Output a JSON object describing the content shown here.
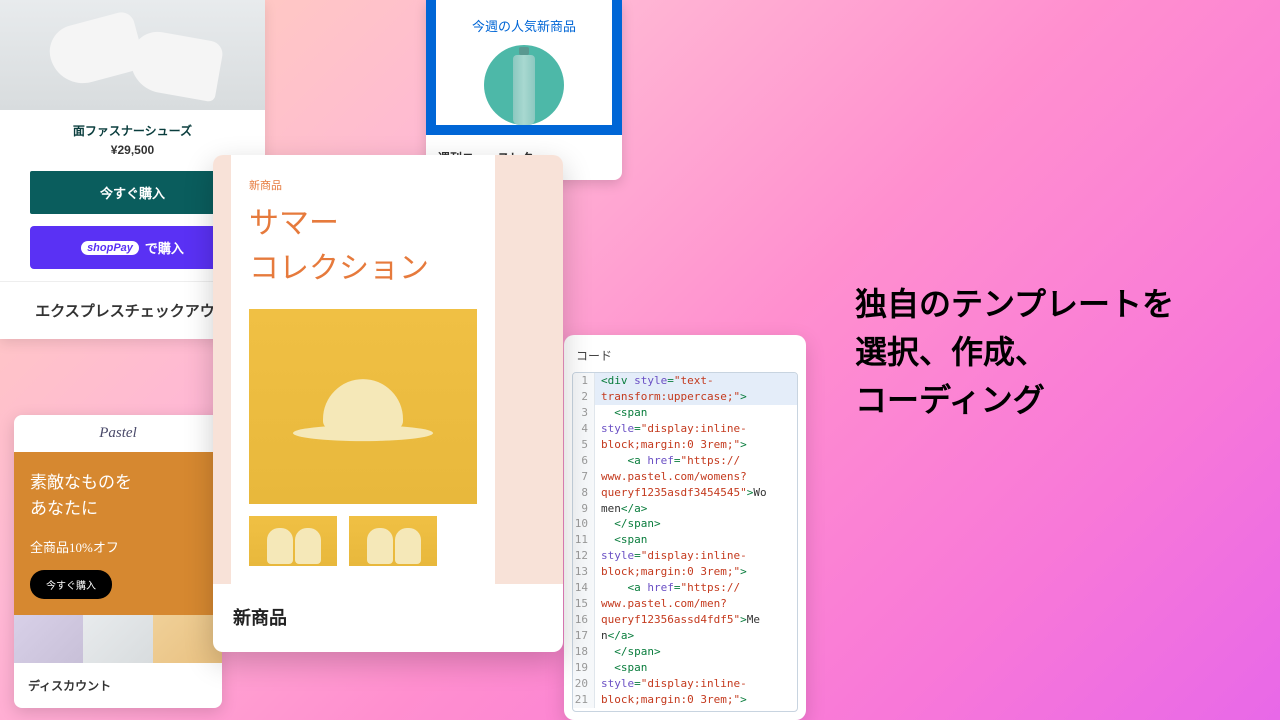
{
  "headline": {
    "line1": "独自のテンプレートを",
    "line2": "選択、作成、",
    "line3": "コーディング"
  },
  "shoes": {
    "title": "面ファスナーシューズ",
    "price": "¥29,500",
    "buy_label": "今すぐ購入",
    "shoppay_logo": "shopPay",
    "shoppay_suffix": "で購入",
    "express_label": "エクスプレスチェックアウト"
  },
  "newsletter": {
    "heading": "今週の人気新商品",
    "footer": "週刊ニュースレター"
  },
  "summer": {
    "tag": "新商品",
    "heading_line1": "サマー",
    "heading_line2": "コレクション",
    "footer": "新商品"
  },
  "pastel": {
    "brand": "Pastel",
    "tagline1": "素敵なものを",
    "tagline2": "あなたに",
    "offer": "全商品10%オフ",
    "buy_label": "今すぐ購入",
    "footer": "ディスカウント"
  },
  "code": {
    "title": "コード",
    "lines": [
      {
        "n": 1,
        "hl": true,
        "parts": [
          [
            "punct",
            "<"
          ],
          [
            "tag",
            "div"
          ],
          [
            "plain",
            " "
          ],
          [
            "attr",
            "style"
          ],
          [
            "punct",
            "="
          ],
          [
            "str",
            "\"text-"
          ]
        ]
      },
      {
        "n": 2,
        "hl": true,
        "parts": [
          [
            "str",
            "transform:uppercase;\""
          ],
          [
            "punct",
            ">"
          ]
        ]
      },
      {
        "n": 3,
        "parts": [
          [
            "plain",
            "  "
          ],
          [
            "punct",
            "<"
          ],
          [
            "tag",
            "span"
          ]
        ]
      },
      {
        "n": 4,
        "parts": [
          [
            "attr",
            "style"
          ],
          [
            "punct",
            "="
          ],
          [
            "str",
            "\"display:inline-"
          ]
        ]
      },
      {
        "n": 5,
        "parts": [
          [
            "str",
            "block;margin:0 3rem;\""
          ],
          [
            "punct",
            ">"
          ]
        ]
      },
      {
        "n": 6,
        "parts": [
          [
            "plain",
            "    "
          ],
          [
            "punct",
            "<"
          ],
          [
            "tag",
            "a"
          ],
          [
            "plain",
            " "
          ],
          [
            "attr",
            "href"
          ],
          [
            "punct",
            "="
          ],
          [
            "str",
            "\"https://"
          ]
        ]
      },
      {
        "n": 7,
        "parts": [
          [
            "str",
            "www.pastel.com/womens?"
          ]
        ]
      },
      {
        "n": 8,
        "parts": [
          [
            "str",
            "queryf1235asdf3454545\""
          ],
          [
            "punct",
            ">"
          ],
          [
            "plain",
            "Wo"
          ]
        ]
      },
      {
        "n": 9,
        "parts": [
          [
            "plain",
            "men"
          ],
          [
            "punct",
            "</"
          ],
          [
            "tag",
            "a"
          ],
          [
            "punct",
            ">"
          ]
        ]
      },
      {
        "n": 10,
        "parts": [
          [
            "plain",
            "  "
          ],
          [
            "punct",
            "</"
          ],
          [
            "tag",
            "span"
          ],
          [
            "punct",
            ">"
          ]
        ]
      },
      {
        "n": 11,
        "parts": [
          [
            "plain",
            "  "
          ],
          [
            "punct",
            "<"
          ],
          [
            "tag",
            "span"
          ]
        ]
      },
      {
        "n": 12,
        "parts": [
          [
            "attr",
            "style"
          ],
          [
            "punct",
            "="
          ],
          [
            "str",
            "\"display:inline-"
          ]
        ]
      },
      {
        "n": 13,
        "parts": [
          [
            "str",
            "block;margin:0 3rem;\""
          ],
          [
            "punct",
            ">"
          ]
        ]
      },
      {
        "n": 14,
        "parts": [
          [
            "plain",
            "    "
          ],
          [
            "punct",
            "<"
          ],
          [
            "tag",
            "a"
          ],
          [
            "plain",
            " "
          ],
          [
            "attr",
            "href"
          ],
          [
            "punct",
            "="
          ],
          [
            "str",
            "\"https://"
          ]
        ]
      },
      {
        "n": 15,
        "parts": [
          [
            "str",
            "www.pastel.com/men?"
          ]
        ]
      },
      {
        "n": 16,
        "parts": [
          [
            "str",
            "queryf12356assd4fdf5\""
          ],
          [
            "punct",
            ">"
          ],
          [
            "plain",
            "Me"
          ]
        ]
      },
      {
        "n": 17,
        "parts": [
          [
            "plain",
            "n"
          ],
          [
            "punct",
            "</"
          ],
          [
            "tag",
            "a"
          ],
          [
            "punct",
            ">"
          ]
        ]
      },
      {
        "n": 18,
        "parts": [
          [
            "plain",
            "  "
          ],
          [
            "punct",
            "</"
          ],
          [
            "tag",
            "span"
          ],
          [
            "punct",
            ">"
          ]
        ]
      },
      {
        "n": 19,
        "parts": [
          [
            "plain",
            "  "
          ],
          [
            "punct",
            "<"
          ],
          [
            "tag",
            "span"
          ]
        ]
      },
      {
        "n": 20,
        "parts": [
          [
            "attr",
            "style"
          ],
          [
            "punct",
            "="
          ],
          [
            "str",
            "\"display:inline-"
          ]
        ]
      },
      {
        "n": 21,
        "parts": [
          [
            "str",
            "block;margin:0 3rem;\""
          ],
          [
            "punct",
            ">"
          ]
        ]
      }
    ]
  }
}
